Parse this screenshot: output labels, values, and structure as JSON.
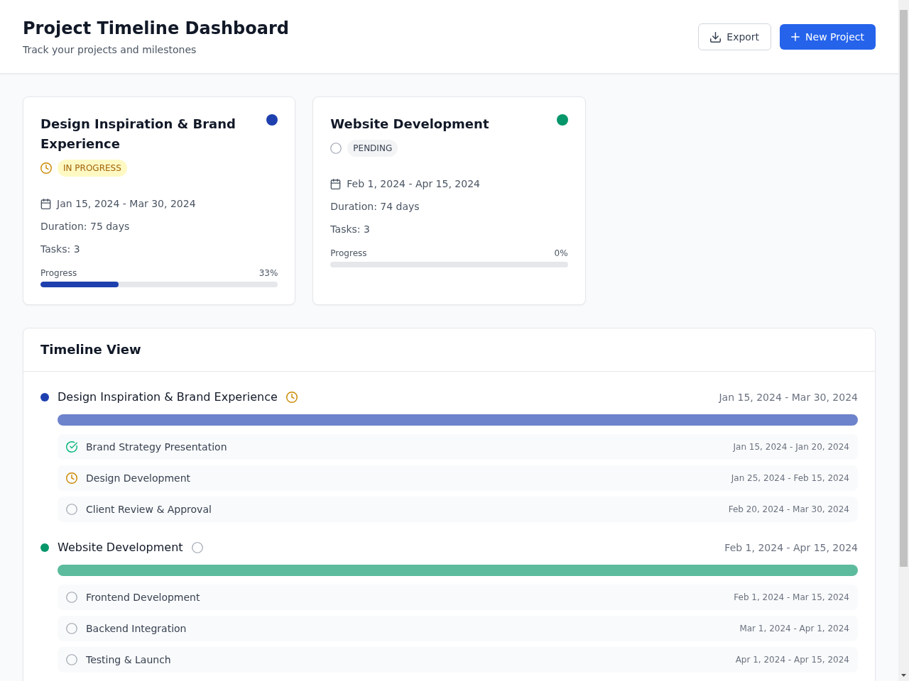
{
  "header": {
    "title": "Project Timeline Dashboard",
    "subtitle": "Track your projects and milestones",
    "buttons": [
      {
        "kind": "secondary",
        "label": "Export"
      },
      {
        "kind": "primary",
        "label": "New Project"
      }
    ]
  },
  "projects": [
    {
      "name": "Design Inspiration & Brand Experience",
      "color": "#1e40af",
      "in_progress": true,
      "status_label": "IN PROGRESS",
      "dates": "Jan 15, 2024 - Mar 30, 2024",
      "duration": "Duration: 75 days",
      "tasks": "Tasks: 3",
      "progress_label": "Progress",
      "progress_value": "33%",
      "level": 0.33
    },
    {
      "name": "Website Development",
      "color": "#059669",
      "in_progress": false,
      "status_label": "PENDING",
      "dates": "Feb 1, 2024 - Apr 15, 2024",
      "duration": "Duration: 74 days",
      "tasks": "Tasks: 3",
      "progress_label": "Progress",
      "progress_value": "0%"
    }
  ],
  "timeline": {
    "title": "Timeline View",
    "projects": [
      {
        "name": "Design Inspiration & Brand Experience",
        "color": "#1e40af",
        "in_progress": true,
        "dates": "Jan 15, 2024 - Mar 30, 2024",
        "tasks": [
          {
            "name": "Brand Strategy Presentation",
            "kind": "done",
            "dates": "Jan 15, 2024 - Jan 20, 2024"
          },
          {
            "name": "Design Development",
            "kind": "active",
            "dates": "Jan 25, 2024 - Feb 15, 2024"
          },
          {
            "name": "Client Review & Approval",
            "kind": "pending",
            "dates": "Feb 20, 2024 - Mar 30, 2024"
          }
        ]
      },
      {
        "name": "Website Development",
        "color": "#059669",
        "in_progress": false,
        "dates": "Feb 1, 2024 - Apr 15, 2024",
        "tasks": [
          {
            "name": "Frontend Development",
            "kind": "pending",
            "dates": "Feb 1, 2024 - Mar 15, 2024"
          },
          {
            "name": "Backend Integration",
            "kind": "pending",
            "dates": "Mar 1, 2024 - Apr 1, 2024"
          },
          {
            "name": "Testing & Launch",
            "kind": "pending",
            "dates": "Apr 1, 2024 - Apr 15, 2024"
          }
        ]
      }
    ]
  }
}
